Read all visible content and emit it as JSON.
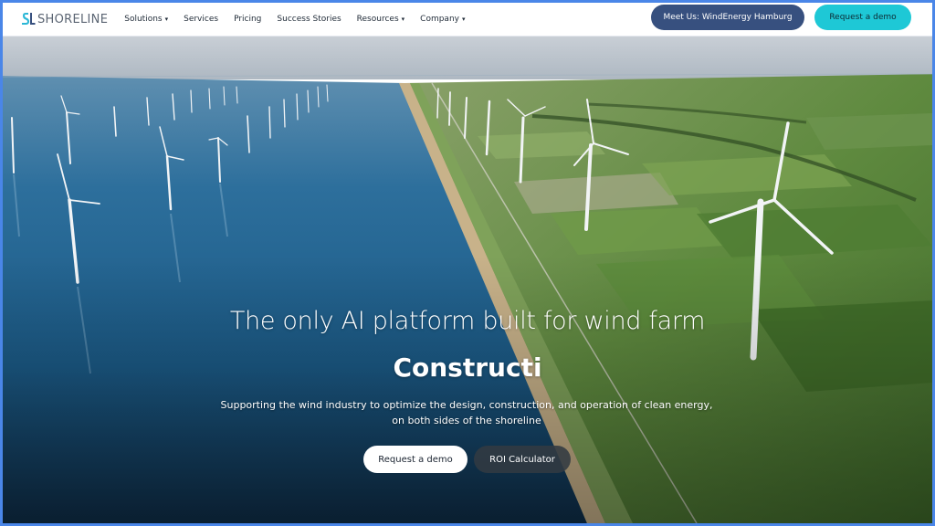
{
  "brand": {
    "logo_mark": "SL",
    "logo_text": "SHORELINE"
  },
  "nav": {
    "items": [
      {
        "label": "Solutions",
        "has_dropdown": true
      },
      {
        "label": "Services",
        "has_dropdown": false
      },
      {
        "label": "Pricing",
        "has_dropdown": false
      },
      {
        "label": "Success Stories",
        "has_dropdown": false
      },
      {
        "label": "Resources",
        "has_dropdown": true
      },
      {
        "label": "Company",
        "has_dropdown": true
      }
    ],
    "chevron_glyph": "⌄",
    "meet_us_label": "Meet Us: WindEnergy Hamburg",
    "request_demo_label": "Request a demo"
  },
  "hero": {
    "headline": "The only AI platform built for wind farm",
    "rotating_word": "Constructi",
    "subtext": "Supporting the wind industry to optimize the design, construction, and operation of clean energy, on both sides of the shoreline",
    "primary_cta": "Request a demo",
    "secondary_cta": "ROI Calculator",
    "background_image": "offshore-and-onshore-wind-turbines-aerial"
  },
  "colors": {
    "frame_border": "#4a86e8",
    "meet_button_bg": "#37507f",
    "demo_button_bg": "#1ec8d6",
    "roi_button_bg": "#323a42",
    "sea": "#1d5d88",
    "fields": "#5e8a3e"
  }
}
